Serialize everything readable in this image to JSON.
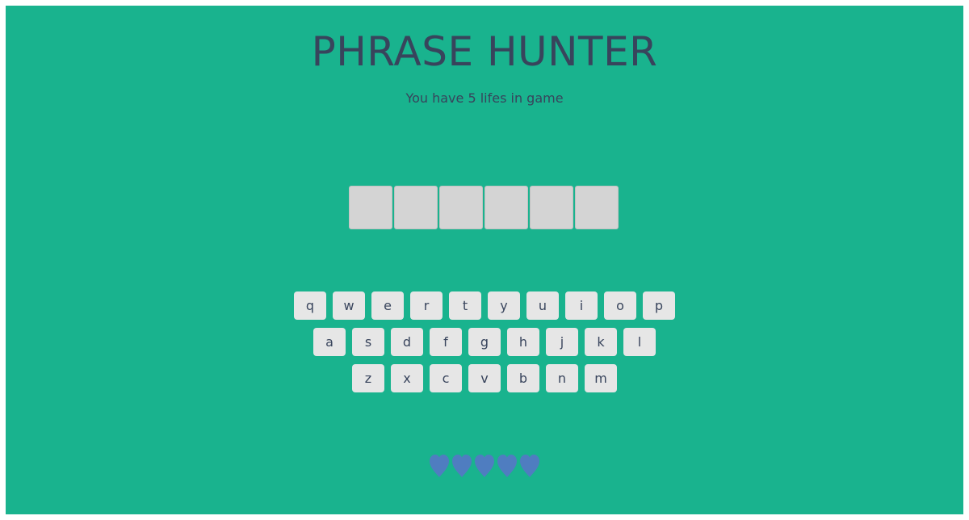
{
  "game": {
    "title": "PHRASE HUNTER",
    "subtitle": "You have 5 lifes in game"
  },
  "phrase": {
    "letters": [
      "",
      "",
      "",
      "",
      "",
      ""
    ]
  },
  "keyboard": {
    "rows": [
      [
        "q",
        "w",
        "e",
        "r",
        "t",
        "y",
        "u",
        "i",
        "o",
        "p"
      ],
      [
        "a",
        "s",
        "d",
        "f",
        "g",
        "h",
        "j",
        "k",
        "l"
      ],
      [
        "z",
        "x",
        "c",
        "v",
        "b",
        "n",
        "m"
      ]
    ]
  },
  "scoreboard": {
    "lives": 5,
    "heart_icon": "heart-icon",
    "heart_color": "#4f7dc0"
  },
  "colors": {
    "background": "#19b38e",
    "text": "#38445c",
    "tile": "#d4d4d4",
    "key": "#e6e6e6"
  }
}
